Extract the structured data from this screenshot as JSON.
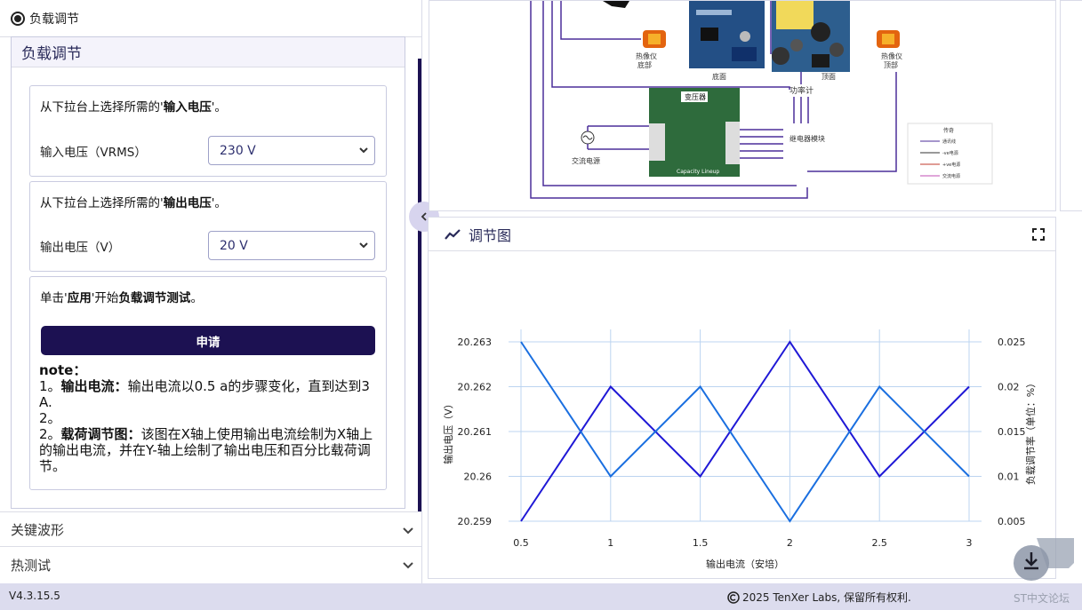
{
  "left_panel": {
    "radio_label": "负载调节",
    "section_title": "负载调节",
    "input_card": {
      "prompt_prefix": "从下拉台上选择所需的'",
      "prompt_bold": "输入电压",
      "prompt_suffix": "'。",
      "field_label": "输入电压（VRMS）",
      "selected": "230 V"
    },
    "output_card": {
      "prompt_prefix": "从下拉台上选择所需的'",
      "prompt_bold": "输出电压",
      "prompt_suffix": "'。",
      "field_label": "输出电压（V）",
      "selected": "20 V"
    },
    "apply_card": {
      "prompt_prefix": "单击'",
      "prompt_bold1": "应用",
      "prompt_mid": "'开始",
      "prompt_bold2": "负载调节测试",
      "prompt_suffix": "。",
      "button_label": "申请"
    },
    "note": {
      "title": "note：",
      "line1_prefix": "1。",
      "line1_bold": "输出电流：",
      "line1_text": "输出电流以0.5 a的步骤变化，直到达到3 A.",
      "line2": "2。",
      "line3_prefix": "2。",
      "line3_bold": "载荷调节图：",
      "line3_text": "该图在X轴上使用输出电流绘制为X轴上的输出电流，并在Y-轴上绘制了输出电压和百分比载荷调节。"
    },
    "accordions": [
      {
        "label": "关键波形"
      },
      {
        "label": "热测试"
      }
    ]
  },
  "diagram": {
    "labels": {
      "thermal_bottom": "热像仪\n底部",
      "bottom": "底面",
      "top": "顶面",
      "thermal_top": "热像仪\n顶部",
      "power_meter": "功率计",
      "transformer": "变压器",
      "relay": "继电器模块",
      "ac_source": "交流电源",
      "board_text": "Capacity Lineup",
      "legend_title": "传奇",
      "legend_items": [
        "通讯线",
        "-ve电源",
        "+ve电源",
        "交流电源"
      ]
    }
  },
  "chart": {
    "title": "调节图"
  },
  "chart_data": {
    "type": "line",
    "x": [
      0.5,
      1,
      1.5,
      2,
      2.5,
      3
    ],
    "xlabel": "输出电流（安培）",
    "ylabel_left": "输出电压（V）",
    "ylabel_right": "负载调节率（单位：%）",
    "ylim_left": [
      20.259,
      20.263
    ],
    "ylim_right": [
      0.005,
      0.025
    ],
    "x_ticks": [
      "0.5",
      "1",
      "1.5",
      "2",
      "2.5",
      "3"
    ],
    "y_left_ticks": [
      "20.259",
      "20.26",
      "20.261",
      "20.262",
      "20.263"
    ],
    "y_right_ticks": [
      "0.005",
      "0.01",
      "0.015",
      "0.02",
      "0.025"
    ],
    "grid": true,
    "series": [
      {
        "axis": "left",
        "color": "#1f18d6",
        "values": [
          20.259,
          20.262,
          20.26,
          20.263,
          20.26,
          20.262
        ]
      },
      {
        "axis": "right",
        "color": "#1a6fe0",
        "values": [
          0.025,
          0.01,
          0.02,
          0.005,
          0.02,
          0.01
        ]
      }
    ]
  },
  "footer": {
    "version": "V4.3.15.5",
    "copyright": "2025 TenXer Labs, 保留所有权利.",
    "forum": "ST中文论坛"
  },
  "colors": {
    "accent": "#1c1152",
    "line_dark": "#1f18d6",
    "line_light": "#1a6fe0",
    "grid": "#bcd4f0",
    "footer_bg": "#dcdcee"
  }
}
